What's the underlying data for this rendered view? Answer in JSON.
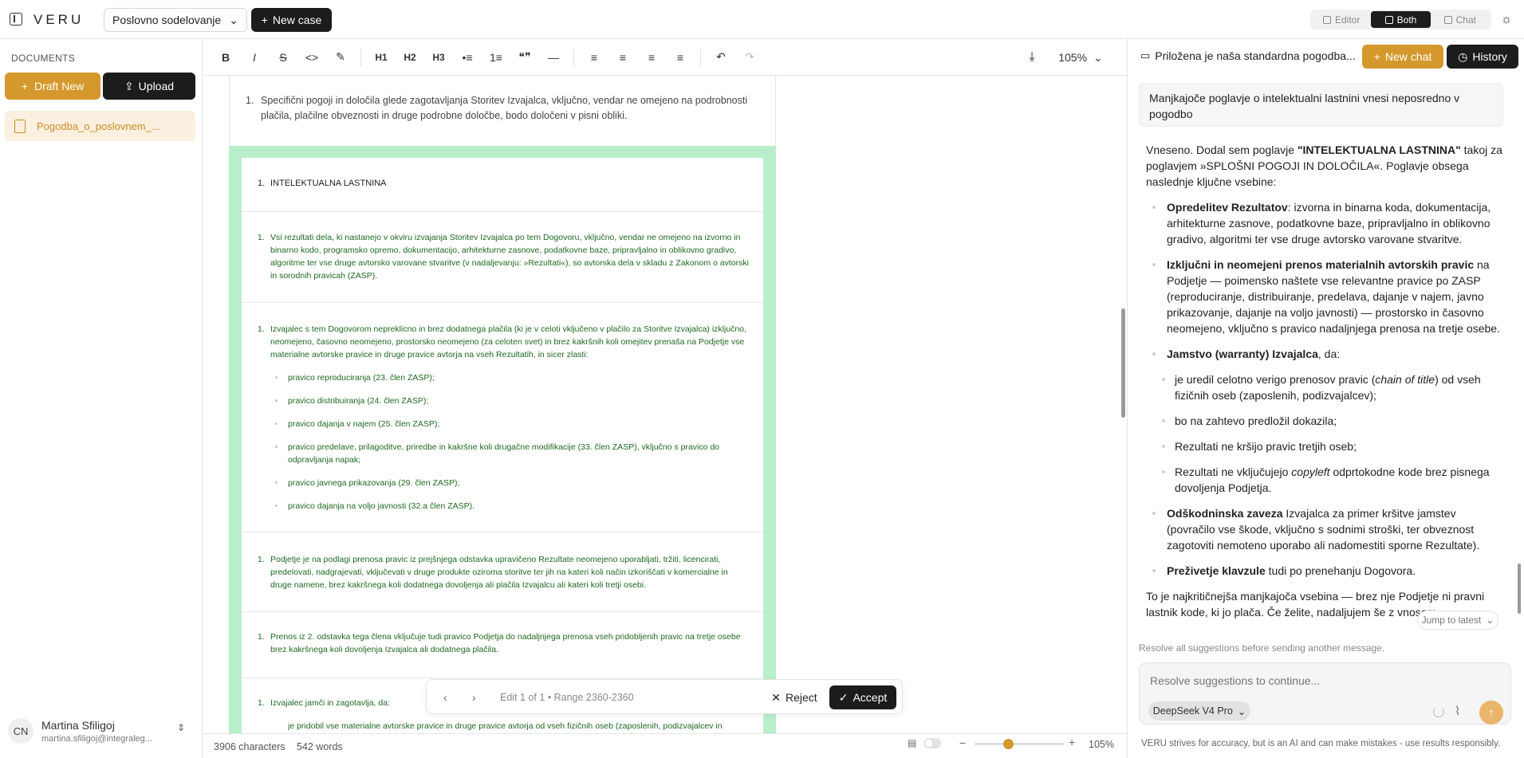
{
  "app": {
    "logo": "VERU"
  },
  "header": {
    "case_name": "Poslovno sodelovanje",
    "new_case_label": "New case",
    "view_modes": [
      {
        "label": "Editor",
        "active": false
      },
      {
        "label": "Both",
        "active": true
      },
      {
        "label": "Chat",
        "active": false
      }
    ]
  },
  "sidebar": {
    "section_label": "DOCUMENTS",
    "draft_label": "Draft New",
    "upload_label": "Upload",
    "documents": [
      {
        "name": "Pogodba_o_poslovnem_..."
      }
    ],
    "user": {
      "initials": "CN",
      "name": "Martina Sfiligoj",
      "email": "martina.sfiligoj@integraleg..."
    }
  },
  "toolbar": {
    "buttons": [
      "B",
      "I",
      "S",
      "<>",
      "✎",
      "H1",
      "H2",
      "H3",
      "•≡",
      "1≡",
      "❝❞",
      "—",
      "≡",
      "≡",
      "≡",
      "≡",
      "↶",
      "↷"
    ],
    "zoom": "105%"
  },
  "document": {
    "top_para": {
      "num": "1.",
      "text": "Specifični pogoji in določila glede zagotavljanja Storitev Izvajalca, vključno, vendar ne omejeno na podrobnosti plačila, plačilne obveznosti in druge podrobne določbe, bodo določeni v pisni obliki."
    },
    "heading": {
      "num": "1.",
      "text": "INTELEKTUALNA LASTNINA"
    },
    "p1": {
      "num": "1.",
      "text": "Vsi rezultati dela, ki nastanejo v okviru izvajanja Storitev Izvajalca po tem Dogovoru, vključno, vendar ne omejeno na izvorno in binarno kodo, programsko opremo, dokumentacijo, arhitekturne zasnove, podatkovne baze, pripravljalno in oblikovno gradivo, algoritme ter vse druge avtorsko varovane stvaritve (v nadaljevanju: »Rezultati«), so avtorska dela v skladu z Zakonom o avtorski in sorodnih pravicah (ZASP)."
    },
    "p2": {
      "num": "1.",
      "text": "Izvajalec s tem Dogovorom nepreklicno in brez dodatnega plačila (ki je v celoti vključeno v plačilo za Storitve Izvajalca) izključno, neomejeno, časovno neomejeno, prostorsko neomejeno (za celoten svet) in brez kakršnih koli omejitev prenaša na Podjetje vse materialne avtorske pravice in druge pravice avtorja na vseh Rezultatih, in sicer zlasti:"
    },
    "bullets": [
      "pravico reproduciranja (23. člen ZASP);",
      "pravico distribuiranja (24. člen ZASP);",
      "pravico dajanja v najem (25. člen ZASP);",
      "pravico predelave, prilagoditve, priredbe in kakršne koli drugačne modifikacije (33. člen ZASP), vključno s pravico do odpravljanja napak;",
      "pravico javnega prikazovanja (29. člen ZASP);",
      "pravico dajanja na voljo javnosti (32.a člen ZASP)."
    ],
    "p3": {
      "num": "1.",
      "text": "Podjetje je na podlagi prenosa pravic iz prejšnjega odstavka upravičeno Rezultate neomejeno uporabljati, tržiti, licencirati, predelovati, nadgrajevati, vključevati v druge produkte oziroma storitve ter jih na kateri koli način izkoriščati v komercialne in druge namene, brez kakršnega koli dodatnega dovoljenja ali plačila Izvajalcu ali kateri koli tretji osebi."
    },
    "p4": {
      "num": "1.",
      "text": "Prenos iz 2. odstavka tega člena vključuje tudi pravico Podjetja do nadaljnjega prenosa vseh pridobljenih pravic na tretje osebe brez kakršnega koli dovoljenja Izvajalca ali dodatnega plačila."
    },
    "p5": {
      "num": "1.",
      "text": "Izvajalec jamči in zagotavlja, da:"
    },
    "p5_bullet": "je pridobil vse materialne avtorske pravice in druge pravice avtorja od vseh fizičnih oseb (zaposlenih, podizvajalcev in"
  },
  "editbar": {
    "prev": "‹",
    "next": "›",
    "info": "Edit 1 of 1 • Range 2360-2360",
    "reject_label": "Reject",
    "accept_label": "Accept"
  },
  "status": {
    "characters": "3906 characters",
    "words": "542 words",
    "zoom": "105%"
  },
  "chat": {
    "title": "Priložena je naša standardna pogodba...",
    "new_chat_label": "New chat",
    "history_label": "History",
    "user_message": "Manjkajoče poglavje o intelektualni lastnini vnesi neposredno v pogodbo",
    "reply": {
      "intro_a": "Vneseno. Dodal sem poglavje ",
      "intro_b": "\"INTELEKTUALNA LASTNINA\"",
      "intro_c": " takoj za poglavjem »SPLOŠNI POGOJI IN DOLOČILA«. Poglavje obsega naslednje ključne vsebine:",
      "items": [
        {
          "bold": "Opredelitev Rezultatov",
          "text": ": izvorna in binarna koda, dokumentacija, arhitekturne zasnove, podatkovne baze, pripravljalno in oblikovno gradivo, algoritmi ter vse druge avtorsko varovane stvaritve."
        },
        {
          "bold": "Izključni in neomejeni prenos materialnih avtorskih pravic",
          "text": " na Podjetje — poimensko naštete vse relevantne pravice po ZASP (reproduciranje, distribuiranje, predelava, dajanje v najem, javno prikazovanje, dajanje na voljo javnosti) — prostorsko in časovno neomejeno, vključno s pravico nadaljnjega prenosa na tretje osebe."
        }
      ],
      "warranty_bold": "Jamstvo (warranty) Izvajalca",
      "warranty_text": ", da:",
      "sub_1a": "je uredil celotno verigo prenosov pravic (",
      "sub_1i": "chain of title",
      "sub_1b": ") od vseh fizičnih oseb (zaposlenih, podizvajalcev);",
      "sub_2": "bo na zahtevo predložil dokazila;",
      "sub_3": "Rezultati ne kršijo pravic tretjih oseb;",
      "sub_4a": "Rezultati ne vključujejo ",
      "sub_4i": "copyleft",
      "sub_4b": " odprtokodne kode brez pisnega dovoljenja Podjetja.",
      "indemnity_bold": "Odškodninska zaveza",
      "indemnity_text": " Izvajalca za primer kršitve jamstev (povračilo vse škode, vključno s sodnimi stroški, ter obveznost zagotoviti nemoteno uporabo ali nadomestiti sporne Rezultate).",
      "survival_bold": "Preživetje klavzule",
      "survival_text": " tudi po prenehanju Dogovora.",
      "outro": "To je najkritičnejša manjkajoča vsebina — brez nje Podjetje ni pravni lastnik kode, ki jo plača. Če želite, nadaljujem še z vnosom"
    },
    "jump_label": "Jump to latest",
    "resolve_note": "Resolve all suggestions before sending another message.",
    "composer_placeholder": "Resolve suggestions to continue...",
    "model": "DeepSeek V4 Pro",
    "disclaimer": "VERU strives for accuracy, but is an AI and can make mistakes - use results responsibly."
  }
}
